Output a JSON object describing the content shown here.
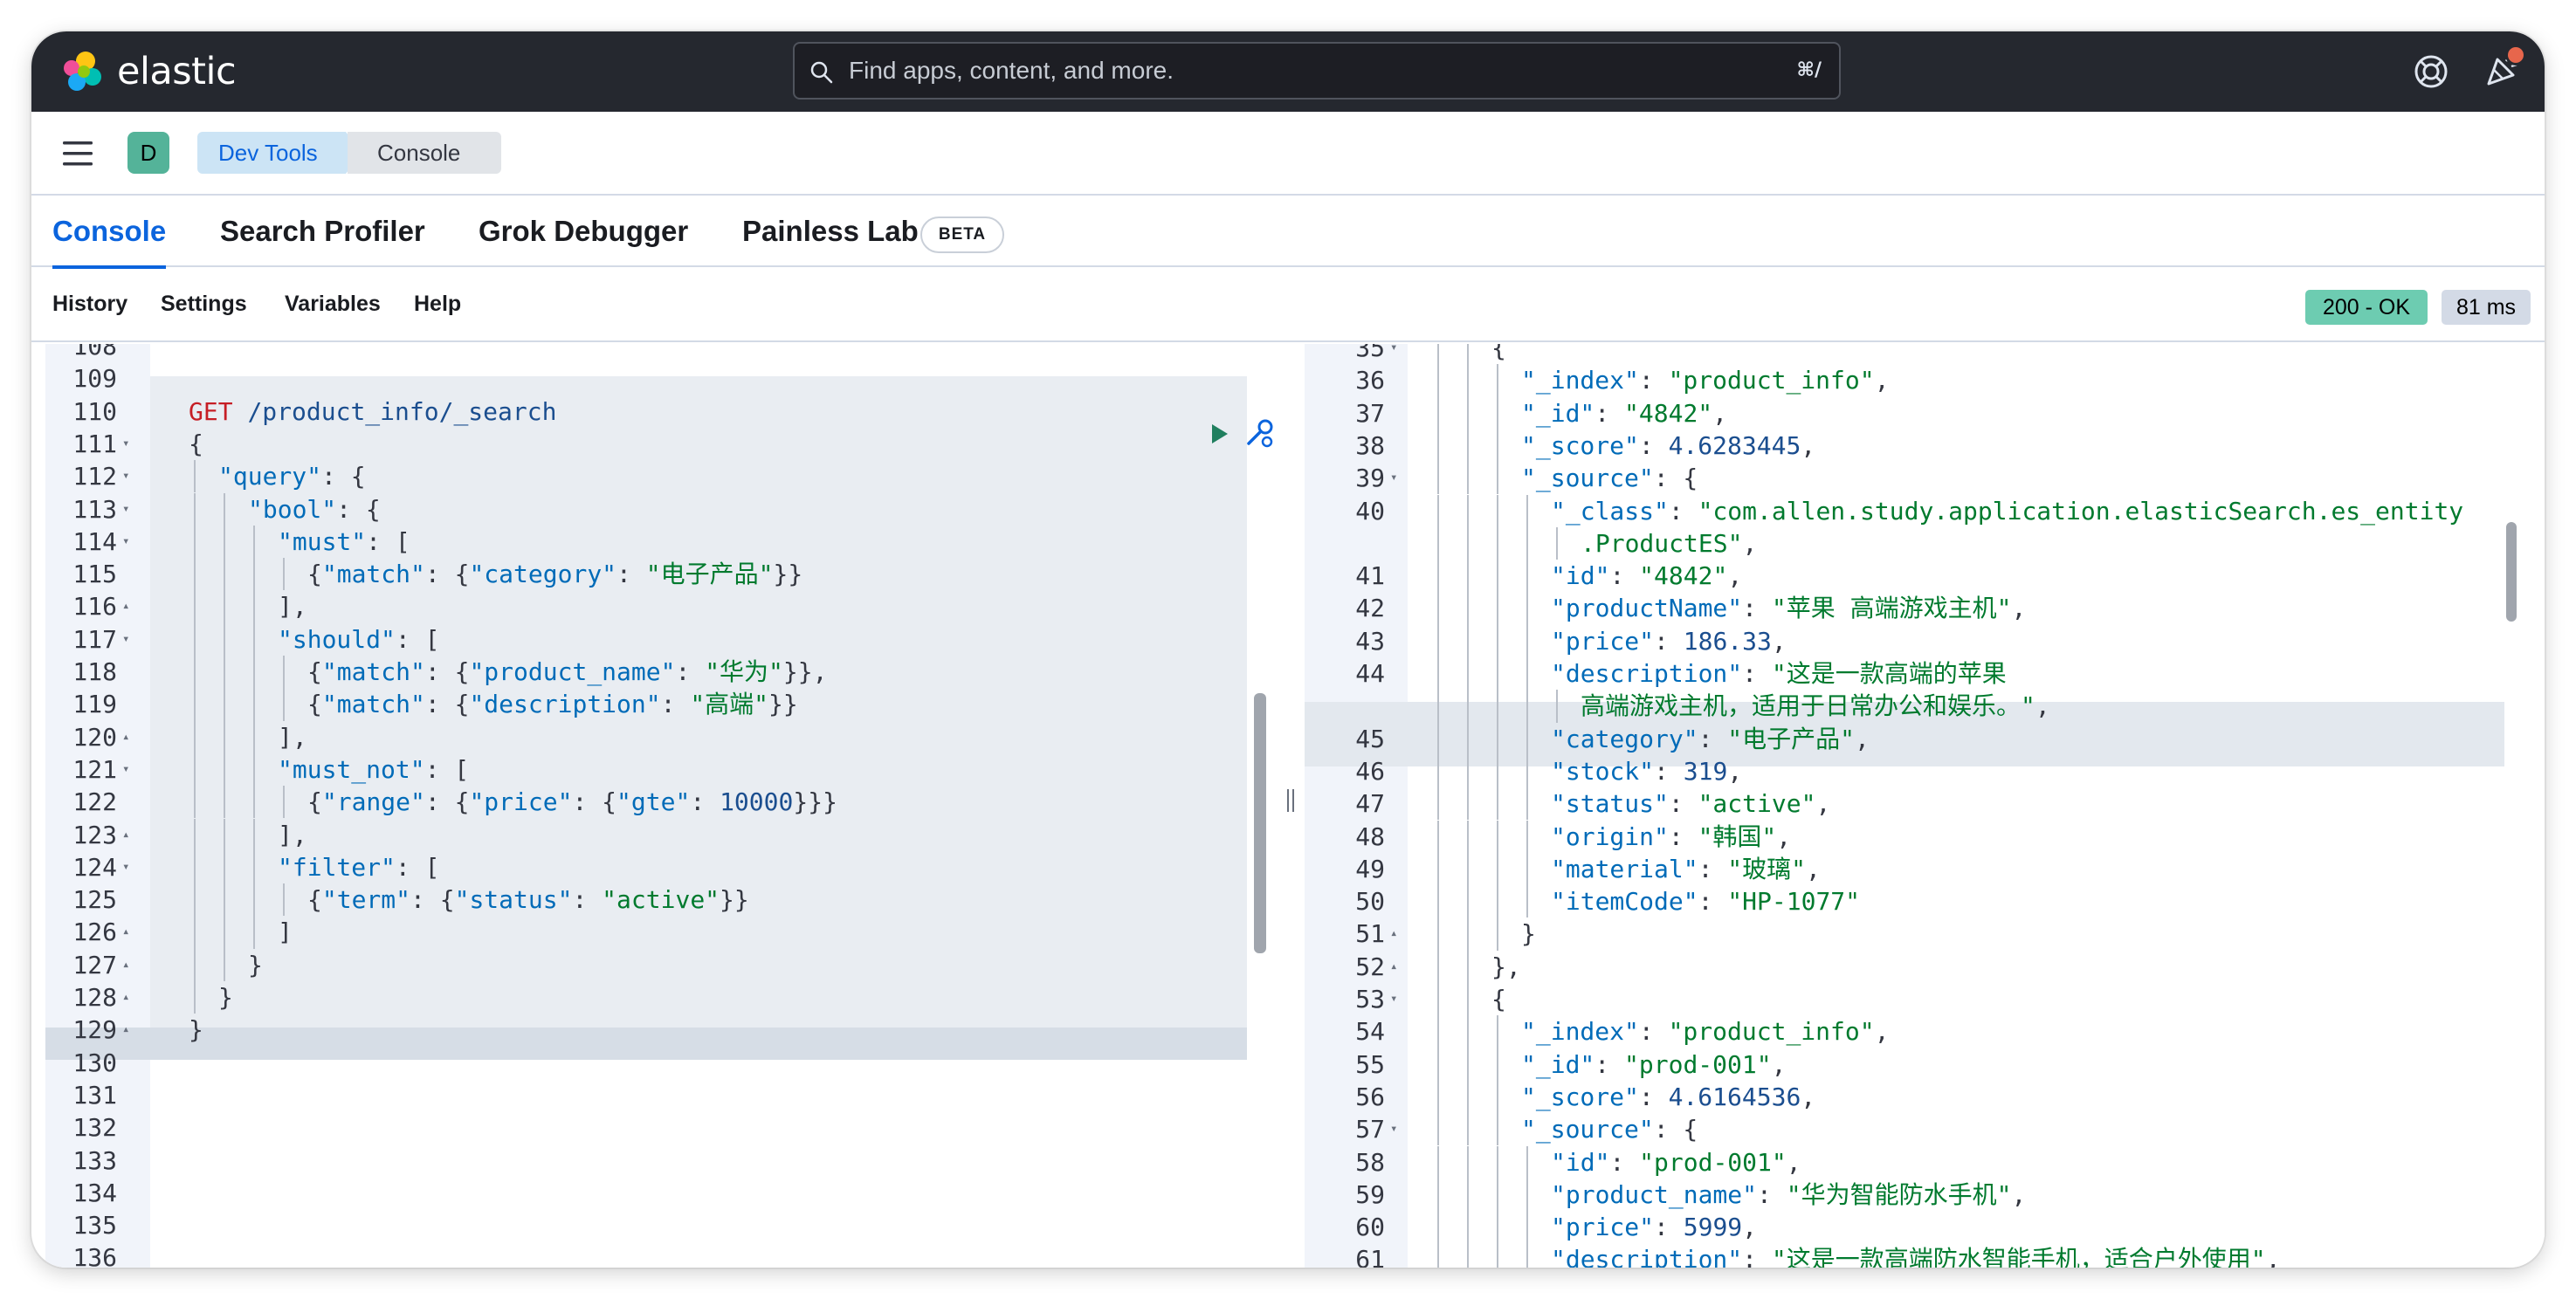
{
  "topbar": {
    "logo_text": "elastic",
    "search_placeholder": "Find apps, content, and more.",
    "search_shortcut": "⌘/"
  },
  "header": {
    "space_initial": "D",
    "breadcrumbs": [
      "Dev Tools",
      "Console"
    ]
  },
  "tabs": [
    {
      "label": "Console",
      "active": true
    },
    {
      "label": "Search Profiler",
      "active": false
    },
    {
      "label": "Grok Debugger",
      "active": false
    },
    {
      "label": "Painless Lab",
      "active": false
    }
  ],
  "beta_badge": "BETA",
  "toolbar": {
    "items": [
      "History",
      "Settings",
      "Variables",
      "Help"
    ],
    "status": "200 - OK",
    "time": "81 ms"
  },
  "colors": {
    "topbar": "#25282f",
    "accent": "#0b64dd",
    "status_ok": "#6dccb1",
    "string": "#007a2e",
    "key": "#006bb8",
    "method": "#c61e25"
  },
  "request_editor": {
    "lines": [
      {
        "n": "108",
        "fold": "",
        "indent": 0,
        "tokens": []
      },
      {
        "n": "109",
        "fold": "",
        "indent": 0,
        "tokens": []
      },
      {
        "n": "110",
        "fold": "",
        "indent": 0,
        "tokens": [
          [
            "m",
            "GET"
          ],
          [
            "p",
            " "
          ],
          [
            "n",
            "/product_info/_search"
          ]
        ]
      },
      {
        "n": "111",
        "fold": "▾",
        "indent": 0,
        "tokens": [
          [
            "p",
            "{"
          ]
        ]
      },
      {
        "n": "112",
        "fold": "▾",
        "indent": 1,
        "tokens": [
          [
            "k",
            "\"query\""
          ],
          [
            "p",
            ": {"
          ]
        ]
      },
      {
        "n": "113",
        "fold": "▾",
        "indent": 2,
        "tokens": [
          [
            "k",
            "\"bool\""
          ],
          [
            "p",
            ": {"
          ]
        ]
      },
      {
        "n": "114",
        "fold": "▾",
        "indent": 3,
        "tokens": [
          [
            "k",
            "\"must\""
          ],
          [
            "p",
            ": ["
          ]
        ]
      },
      {
        "n": "115",
        "fold": "",
        "indent": 4,
        "tokens": [
          [
            "p",
            "{"
          ],
          [
            "k",
            "\"match\""
          ],
          [
            "p",
            ": {"
          ],
          [
            "k",
            "\"category\""
          ],
          [
            "p",
            ": "
          ],
          [
            "s",
            "\"电子产品\""
          ],
          [
            "p",
            "}}"
          ]
        ]
      },
      {
        "n": "116",
        "fold": "▴",
        "indent": 3,
        "tokens": [
          [
            "p",
            "],"
          ]
        ]
      },
      {
        "n": "117",
        "fold": "▾",
        "indent": 3,
        "tokens": [
          [
            "k",
            "\"should\""
          ],
          [
            "p",
            ": ["
          ]
        ]
      },
      {
        "n": "118",
        "fold": "",
        "indent": 4,
        "tokens": [
          [
            "p",
            "{"
          ],
          [
            "k",
            "\"match\""
          ],
          [
            "p",
            ": {"
          ],
          [
            "k",
            "\"product_name\""
          ],
          [
            "p",
            ": "
          ],
          [
            "s",
            "\"华为\""
          ],
          [
            "p",
            "}},"
          ]
        ]
      },
      {
        "n": "119",
        "fold": "",
        "indent": 4,
        "tokens": [
          [
            "p",
            "{"
          ],
          [
            "k",
            "\"match\""
          ],
          [
            "p",
            ": {"
          ],
          [
            "k",
            "\"description\""
          ],
          [
            "p",
            ": "
          ],
          [
            "s",
            "\"高端\""
          ],
          [
            "p",
            "}}"
          ]
        ]
      },
      {
        "n": "120",
        "fold": "▴",
        "indent": 3,
        "tokens": [
          [
            "p",
            "],"
          ]
        ]
      },
      {
        "n": "121",
        "fold": "▾",
        "indent": 3,
        "tokens": [
          [
            "k",
            "\"must_not\""
          ],
          [
            "p",
            ": ["
          ]
        ]
      },
      {
        "n": "122",
        "fold": "",
        "indent": 4,
        "tokens": [
          [
            "p",
            "{"
          ],
          [
            "k",
            "\"range\""
          ],
          [
            "p",
            ": {"
          ],
          [
            "k",
            "\"price\""
          ],
          [
            "p",
            ": {"
          ],
          [
            "k",
            "\"gte\""
          ],
          [
            "p",
            ": "
          ],
          [
            "n",
            "10000"
          ],
          [
            "p",
            "}}}"
          ]
        ]
      },
      {
        "n": "123",
        "fold": "▴",
        "indent": 3,
        "tokens": [
          [
            "p",
            "],"
          ]
        ]
      },
      {
        "n": "124",
        "fold": "▾",
        "indent": 3,
        "tokens": [
          [
            "k",
            "\"filter\""
          ],
          [
            "p",
            ": ["
          ]
        ]
      },
      {
        "n": "125",
        "fold": "",
        "indent": 4,
        "tokens": [
          [
            "p",
            "{"
          ],
          [
            "k",
            "\"term\""
          ],
          [
            "p",
            ": {"
          ],
          [
            "k",
            "\"status\""
          ],
          [
            "p",
            ": "
          ],
          [
            "s",
            "\"active\""
          ],
          [
            "p",
            "}}"
          ]
        ]
      },
      {
        "n": "126",
        "fold": "▴",
        "indent": 3,
        "tokens": [
          [
            "p",
            "]"
          ]
        ]
      },
      {
        "n": "127",
        "fold": "▴",
        "indent": 2,
        "tokens": [
          [
            "p",
            "}"
          ]
        ]
      },
      {
        "n": "128",
        "fold": "▴",
        "indent": 1,
        "tokens": [
          [
            "p",
            "}"
          ]
        ]
      },
      {
        "n": "129",
        "fold": "▴",
        "indent": 0,
        "tokens": [
          [
            "p",
            "}"
          ]
        ]
      },
      {
        "n": "130",
        "fold": "",
        "indent": 0,
        "tokens": []
      },
      {
        "n": "131",
        "fold": "",
        "indent": 0,
        "tokens": []
      },
      {
        "n": "132",
        "fold": "",
        "indent": 0,
        "tokens": []
      },
      {
        "n": "133",
        "fold": "",
        "indent": 0,
        "tokens": []
      },
      {
        "n": "134",
        "fold": "",
        "indent": 0,
        "tokens": []
      },
      {
        "n": "135",
        "fold": "",
        "indent": 0,
        "tokens": []
      },
      {
        "n": "136",
        "fold": "",
        "indent": 0,
        "tokens": []
      }
    ]
  },
  "response_editor": {
    "lines": [
      {
        "n": "35",
        "fold": "▾",
        "indent": 2,
        "tokens": [
          [
            "p",
            "{"
          ]
        ]
      },
      {
        "n": "36",
        "fold": "",
        "indent": 3,
        "tokens": [
          [
            "k",
            "\"_index\""
          ],
          [
            "p",
            ": "
          ],
          [
            "s",
            "\"product_info\""
          ],
          [
            "p",
            ","
          ]
        ]
      },
      {
        "n": "37",
        "fold": "",
        "indent": 3,
        "tokens": [
          [
            "k",
            "\"_id\""
          ],
          [
            "p",
            ": "
          ],
          [
            "s",
            "\"4842\""
          ],
          [
            "p",
            ","
          ]
        ]
      },
      {
        "n": "38",
        "fold": "",
        "indent": 3,
        "tokens": [
          [
            "k",
            "\"_score\""
          ],
          [
            "p",
            ": "
          ],
          [
            "n",
            "4.6283445"
          ],
          [
            "p",
            ","
          ]
        ]
      },
      {
        "n": "39",
        "fold": "▾",
        "indent": 3,
        "tokens": [
          [
            "k",
            "\"_source\""
          ],
          [
            "p",
            ": {"
          ]
        ]
      },
      {
        "n": "40",
        "fold": "",
        "indent": 4,
        "tokens": [
          [
            "k",
            "\"_class\""
          ],
          [
            "p",
            ": "
          ],
          [
            "s",
            "\"com.allen.study.application.elasticSearch.es_entity"
          ]
        ]
      },
      {
        "n": "",
        "fold": "",
        "indent": 5,
        "tokens": [
          [
            "s",
            ".ProductES\""
          ],
          [
            "p",
            ","
          ]
        ]
      },
      {
        "n": "41",
        "fold": "",
        "indent": 4,
        "tokens": [
          [
            "k",
            "\"id\""
          ],
          [
            "p",
            ": "
          ],
          [
            "s",
            "\"4842\""
          ],
          [
            "p",
            ","
          ]
        ]
      },
      {
        "n": "42",
        "fold": "",
        "indent": 4,
        "tokens": [
          [
            "k",
            "\"productName\""
          ],
          [
            "p",
            ": "
          ],
          [
            "s",
            "\"苹果 高端游戏主机\""
          ],
          [
            "p",
            ","
          ]
        ]
      },
      {
        "n": "43",
        "fold": "",
        "indent": 4,
        "tokens": [
          [
            "k",
            "\"price\""
          ],
          [
            "p",
            ": "
          ],
          [
            "n",
            "186.33"
          ],
          [
            "p",
            ","
          ]
        ]
      },
      {
        "n": "44",
        "fold": "",
        "indent": 4,
        "tokens": [
          [
            "k",
            "\"description\""
          ],
          [
            "p",
            ": "
          ],
          [
            "s",
            "\"这是一款高端的苹果"
          ]
        ]
      },
      {
        "n": "",
        "fold": "",
        "indent": 5,
        "tokens": [
          [
            "s",
            "高端游戏主机，适用于日常办公和娱乐。\""
          ],
          [
            "p",
            ","
          ]
        ]
      },
      {
        "n": "45",
        "fold": "",
        "indent": 4,
        "tokens": [
          [
            "k",
            "\"category\""
          ],
          [
            "p",
            ": "
          ],
          [
            "s",
            "\"电子产品\""
          ],
          [
            "p",
            ","
          ]
        ]
      },
      {
        "n": "46",
        "fold": "",
        "indent": 4,
        "tokens": [
          [
            "k",
            "\"stock\""
          ],
          [
            "p",
            ": "
          ],
          [
            "n",
            "319"
          ],
          [
            "p",
            ","
          ]
        ]
      },
      {
        "n": "47",
        "fold": "",
        "indent": 4,
        "tokens": [
          [
            "k",
            "\"status\""
          ],
          [
            "p",
            ": "
          ],
          [
            "s",
            "\"active\""
          ],
          [
            "p",
            ","
          ]
        ]
      },
      {
        "n": "48",
        "fold": "",
        "indent": 4,
        "tokens": [
          [
            "k",
            "\"origin\""
          ],
          [
            "p",
            ": "
          ],
          [
            "s",
            "\"韩国\""
          ],
          [
            "p",
            ","
          ]
        ]
      },
      {
        "n": "49",
        "fold": "",
        "indent": 4,
        "tokens": [
          [
            "k",
            "\"material\""
          ],
          [
            "p",
            ": "
          ],
          [
            "s",
            "\"玻璃\""
          ],
          [
            "p",
            ","
          ]
        ]
      },
      {
        "n": "50",
        "fold": "",
        "indent": 4,
        "tokens": [
          [
            "k",
            "\"itemCode\""
          ],
          [
            "p",
            ": "
          ],
          [
            "s",
            "\"HP-1077\""
          ]
        ]
      },
      {
        "n": "51",
        "fold": "▴",
        "indent": 3,
        "tokens": [
          [
            "p",
            "}"
          ]
        ]
      },
      {
        "n": "52",
        "fold": "▴",
        "indent": 2,
        "tokens": [
          [
            "p",
            "},"
          ]
        ]
      },
      {
        "n": "53",
        "fold": "▾",
        "indent": 2,
        "tokens": [
          [
            "p",
            "{"
          ]
        ]
      },
      {
        "n": "54",
        "fold": "",
        "indent": 3,
        "tokens": [
          [
            "k",
            "\"_index\""
          ],
          [
            "p",
            ": "
          ],
          [
            "s",
            "\"product_info\""
          ],
          [
            "p",
            ","
          ]
        ]
      },
      {
        "n": "55",
        "fold": "",
        "indent": 3,
        "tokens": [
          [
            "k",
            "\"_id\""
          ],
          [
            "p",
            ": "
          ],
          [
            "s",
            "\"prod-001\""
          ],
          [
            "p",
            ","
          ]
        ]
      },
      {
        "n": "56",
        "fold": "",
        "indent": 3,
        "tokens": [
          [
            "k",
            "\"_score\""
          ],
          [
            "p",
            ": "
          ],
          [
            "n",
            "4.6164536"
          ],
          [
            "p",
            ","
          ]
        ]
      },
      {
        "n": "57",
        "fold": "▾",
        "indent": 3,
        "tokens": [
          [
            "k",
            "\"_source\""
          ],
          [
            "p",
            ": {"
          ]
        ]
      },
      {
        "n": "58",
        "fold": "",
        "indent": 4,
        "tokens": [
          [
            "k",
            "\"id\""
          ],
          [
            "p",
            ": "
          ],
          [
            "s",
            "\"prod-001\""
          ],
          [
            "p",
            ","
          ]
        ]
      },
      {
        "n": "59",
        "fold": "",
        "indent": 4,
        "tokens": [
          [
            "k",
            "\"product_name\""
          ],
          [
            "p",
            ": "
          ],
          [
            "s",
            "\"华为智能防水手机\""
          ],
          [
            "p",
            ","
          ]
        ]
      },
      {
        "n": "60",
        "fold": "",
        "indent": 4,
        "tokens": [
          [
            "k",
            "\"price\""
          ],
          [
            "p",
            ": "
          ],
          [
            "n",
            "5999"
          ],
          [
            "p",
            ","
          ]
        ]
      },
      {
        "n": "61",
        "fold": "",
        "indent": 4,
        "tokens": [
          [
            "k",
            "\"description\""
          ],
          [
            "p",
            ": "
          ],
          [
            "s",
            "\"这是一款高端防水智能手机，适合户外使用\""
          ],
          [
            "p",
            ","
          ]
        ]
      }
    ]
  }
}
